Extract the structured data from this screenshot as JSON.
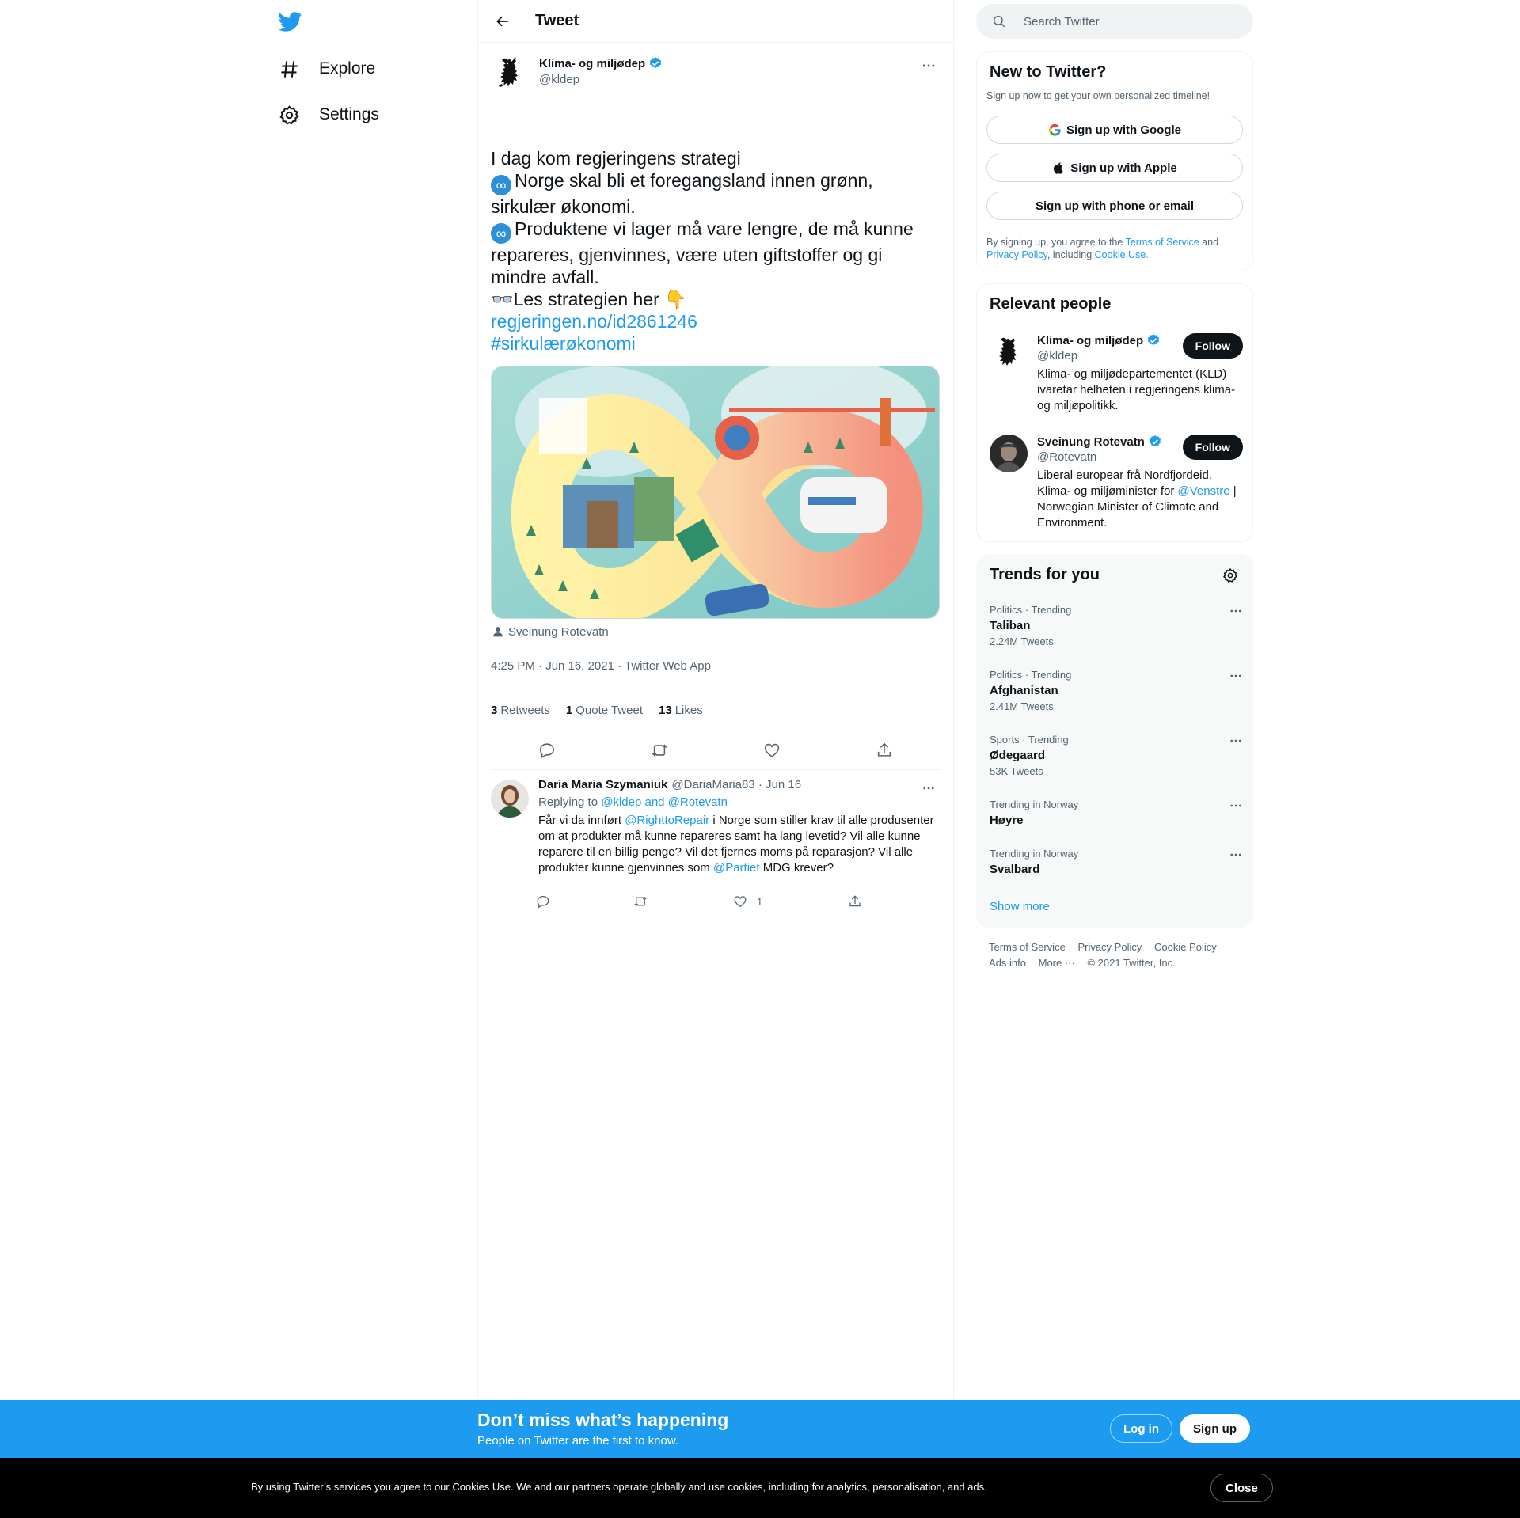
{
  "nav": {
    "items": [
      {
        "label": "Explore",
        "icon": "hashtag-icon"
      },
      {
        "label": "Settings",
        "icon": "gear-icon"
      }
    ]
  },
  "header": {
    "title": "Tweet"
  },
  "tweet": {
    "author_name": "Klima- og miljødep",
    "author_handle": "@kldep",
    "lines": {
      "l1": "I dag kom regjeringens strategi",
      "l2": "Norge skal bli et foregangsland innen grønn, sirkulær økonomi.",
      "l3": "Produktene vi lager må vare lengre, de må kunne repareres, gjenvinnes, være uten giftstoffer og gi mindre avfall.",
      "l4": "👓Les strategien her 👇",
      "link": "regjeringen.no/id2861246",
      "hashtag": "#sirkulærøkonomi"
    },
    "media_tag": "Sveinung Rotevatn",
    "timestamp": "4:25 PM · Jun 16, 2021 · Twitter Web App",
    "stats": {
      "retweets_count": "3",
      "retweets_label": "Retweets",
      "quotes_count": "1",
      "quotes_label": "Quote Tweet",
      "likes_count": "13",
      "likes_label": "Likes"
    }
  },
  "reply": {
    "name": "Daria Maria Szymaniuk",
    "meta": "@DariaMaria83 · Jun 16",
    "replying_label": "Replying to",
    "replying_targets": "@kldep and @Rotevatn",
    "body_1": "Får vi da innført ",
    "mention_1": "@RighttoRepair",
    "body_2": " i Norge som stiller krav til alle produsenter om at produkter må kunne repareres samt ha lang levetid? Vil alle kunne reparere til en billig penge? Vil det fjernes moms på reparasjon? Vil alle produkter kunne gjenvinnes som ",
    "mention_2": "@Partiet",
    "body_3": " MDG krever?",
    "likes": "1"
  },
  "search": {
    "placeholder": "Search Twitter"
  },
  "new_to_twitter": {
    "title": "New to Twitter?",
    "subtitle": "Sign up now to get your own personalized timeline!",
    "google": "Sign up with Google",
    "apple": "Sign up with Apple",
    "phone": "Sign up with phone or email",
    "legal_1": "By signing up, you agree to the ",
    "terms": "Terms of Service",
    "legal_2": " and ",
    "privacy": "Privacy Policy",
    "legal_3": ", including ",
    "cookie": "Cookie Use."
  },
  "relevant": {
    "title": "Relevant people",
    "people": [
      {
        "name": "Klima- og miljødep",
        "handle": "@kldep",
        "bio": "Klima- og miljødepartementet (KLD) ivaretar helheten i regjeringens klima- og miljøpolitikk.",
        "follow": "Follow"
      },
      {
        "name": "Sveinung Rotevatn",
        "handle": "@Rotevatn",
        "bio_1": "Liberal europear frå Nordfjordeid. Klima- og miljøminister for ",
        "bio_mention": "@Venstre",
        "bio_2": " | Norwegian Minister of Climate and Environment.",
        "follow": "Follow"
      }
    ]
  },
  "trends": {
    "title": "Trends for you",
    "items": [
      {
        "category": "Politics · Trending",
        "name": "Taliban",
        "count": "2.24M Tweets"
      },
      {
        "category": "Politics · Trending",
        "name": "Afghanistan",
        "count": "2.41M Tweets"
      },
      {
        "category": "Sports · Trending",
        "name": "Ødegaard",
        "count": "53K Tweets"
      },
      {
        "category": "Trending in Norway",
        "name": "Høyre",
        "count": ""
      },
      {
        "category": "Trending in Norway",
        "name": "Svalbard",
        "count": ""
      }
    ],
    "show_more": "Show more"
  },
  "footer": {
    "terms": "Terms of Service",
    "privacy": "Privacy Policy",
    "cookie": "Cookie Policy",
    "ads": "Ads info",
    "more": "More ···",
    "copyright": "© 2021 Twitter, Inc."
  },
  "signup_bar": {
    "title": "Don’t miss what’s happening",
    "subtitle": "People on Twitter are the first to know.",
    "login": "Log in",
    "signup": "Sign up"
  },
  "cookie_bar": {
    "text": "By using Twitter’s services you agree to our Cookies Use. We and our partners operate globally and use cookies, including for analytics, personalisation, and ads.",
    "close": "Close"
  },
  "colors": {
    "accent": "#1d9bf0",
    "text": "#0f1419",
    "muted": "#536471",
    "border": "#eff3f4"
  }
}
